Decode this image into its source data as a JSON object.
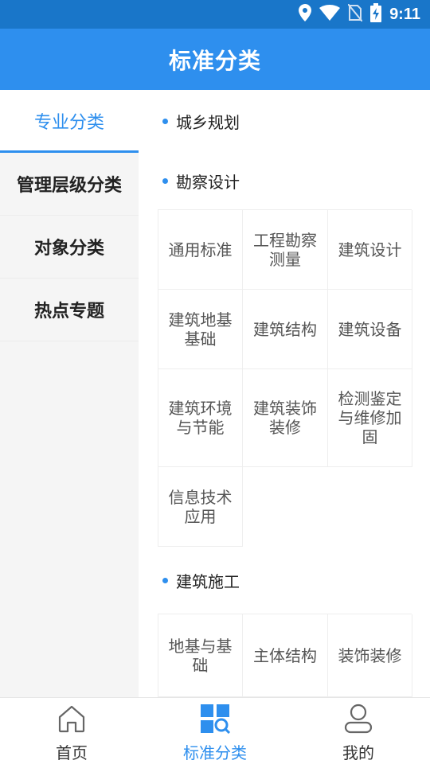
{
  "status_bar": {
    "time": "9:11",
    "icons": [
      "location-icon",
      "wifi-icon",
      "no-sim-icon",
      "battery-charging-icon"
    ]
  },
  "header": {
    "title": "标准分类"
  },
  "sidebar": {
    "items": [
      {
        "label": "专业分类",
        "active": true
      },
      {
        "label": "管理层级分类",
        "active": false
      },
      {
        "label": "对象分类",
        "active": false
      },
      {
        "label": "热点专题",
        "active": false
      }
    ]
  },
  "content": {
    "sections": [
      {
        "title": "城乡规划",
        "items": []
      },
      {
        "title": "勘察设计",
        "items": [
          "通用标准",
          "工程勘察测量",
          "建筑设计",
          "建筑地基基础",
          "建筑结构",
          "建筑设备",
          "建筑环境与节能",
          "建筑装饰装修",
          "检测鉴定与维修加固",
          "信息技术应用"
        ]
      },
      {
        "title": "建筑施工",
        "items": [
          "地基与基础",
          "主体结构",
          "装饰装修"
        ]
      }
    ]
  },
  "bottom_nav": {
    "items": [
      {
        "label": "首页",
        "icon": "home-icon",
        "active": false
      },
      {
        "label": "标准分类",
        "icon": "category-search-icon",
        "active": true
      },
      {
        "label": "我的",
        "icon": "user-icon",
        "active": false
      }
    ]
  },
  "colors": {
    "primary": "#2e8fee",
    "status_bar": "#1976c9",
    "sidebar_bg": "#f5f5f5"
  }
}
